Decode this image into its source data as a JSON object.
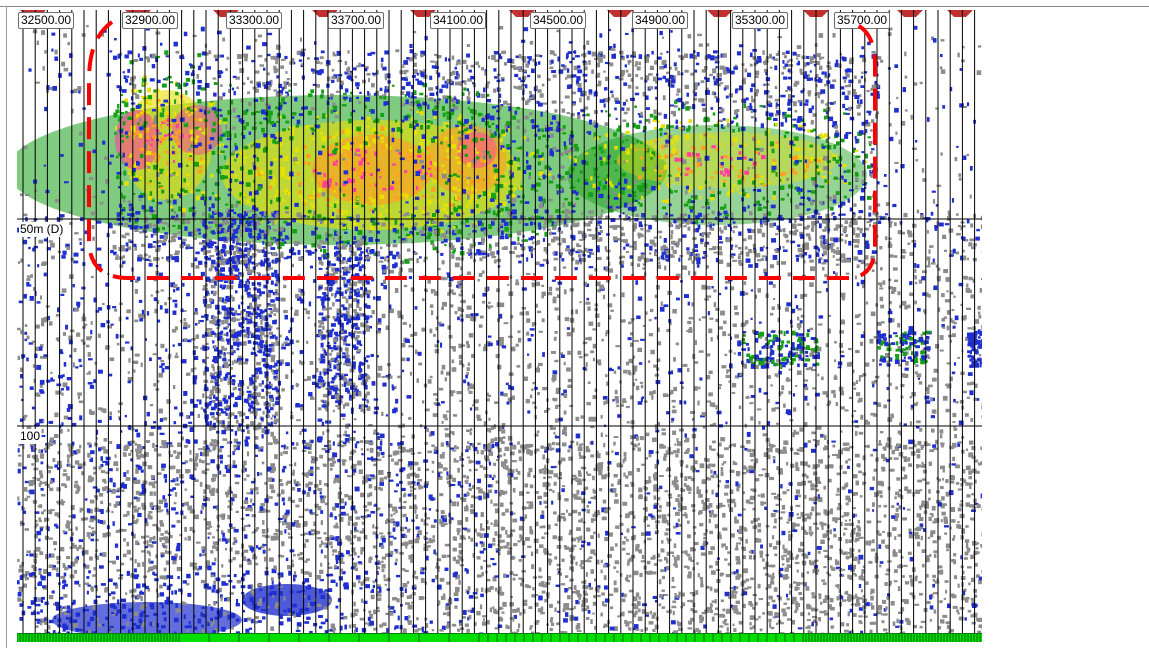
{
  "echogram": {
    "ping_labels": [
      "32500.00",
      "32900.00",
      "33300.00",
      "33700.00",
      "34100.00",
      "34500.00",
      "34900.00",
      "35300.00",
      "35700.00"
    ],
    "depth_labels": [
      "50m (D)",
      "100"
    ],
    "colors": {
      "background": "#ffffff",
      "grid": "#000000",
      "weak": "#8c8c8c",
      "low": "#1f2fd0",
      "mid": "#15a015",
      "high": "#e8e000",
      "higher": "#ffa020",
      "max": "#ff3fa0",
      "selection": "#ff0000",
      "strip": "#00e000"
    }
  }
}
